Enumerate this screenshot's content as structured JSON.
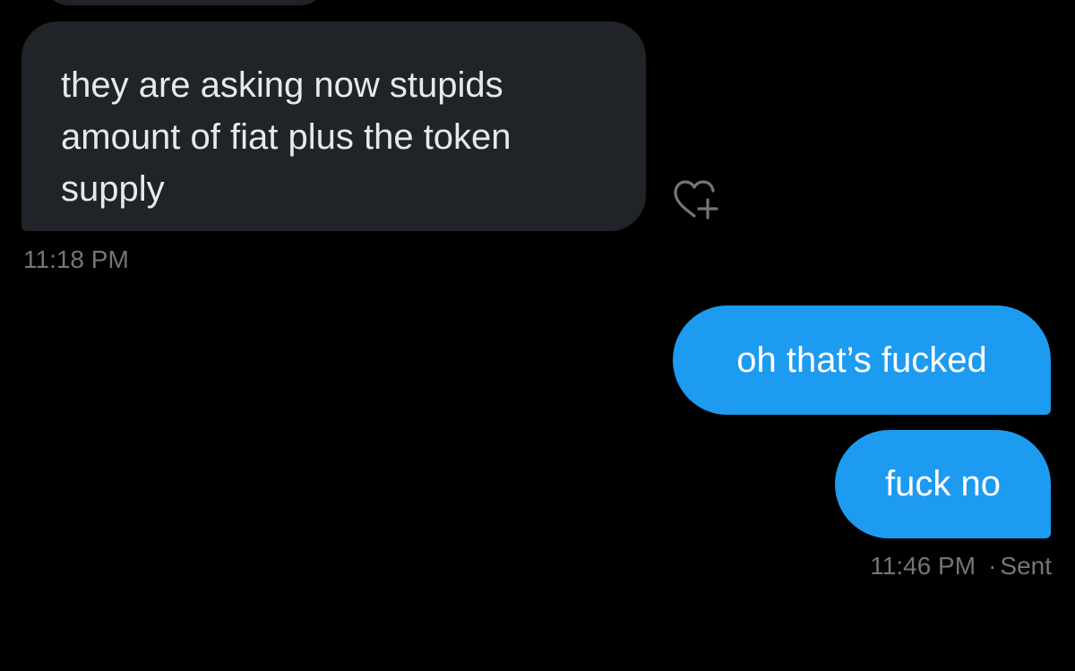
{
  "conversation": {
    "incoming": {
      "text": "they are asking now stupids amount of fiat plus the token supply",
      "time": "11:18 PM"
    },
    "outgoing": [
      {
        "text": "oh that’s fucked"
      },
      {
        "text": "fuck no"
      }
    ],
    "outgoing_meta": {
      "time": "11:46 PM",
      "separator": "·",
      "status": "Sent"
    }
  },
  "colors": {
    "background": "#000000",
    "incoming_bubble": "#202327",
    "outgoing_bubble": "#1d9bf0",
    "secondary_text": "#71767b"
  },
  "icons": {
    "reaction": "heart-plus-icon"
  }
}
